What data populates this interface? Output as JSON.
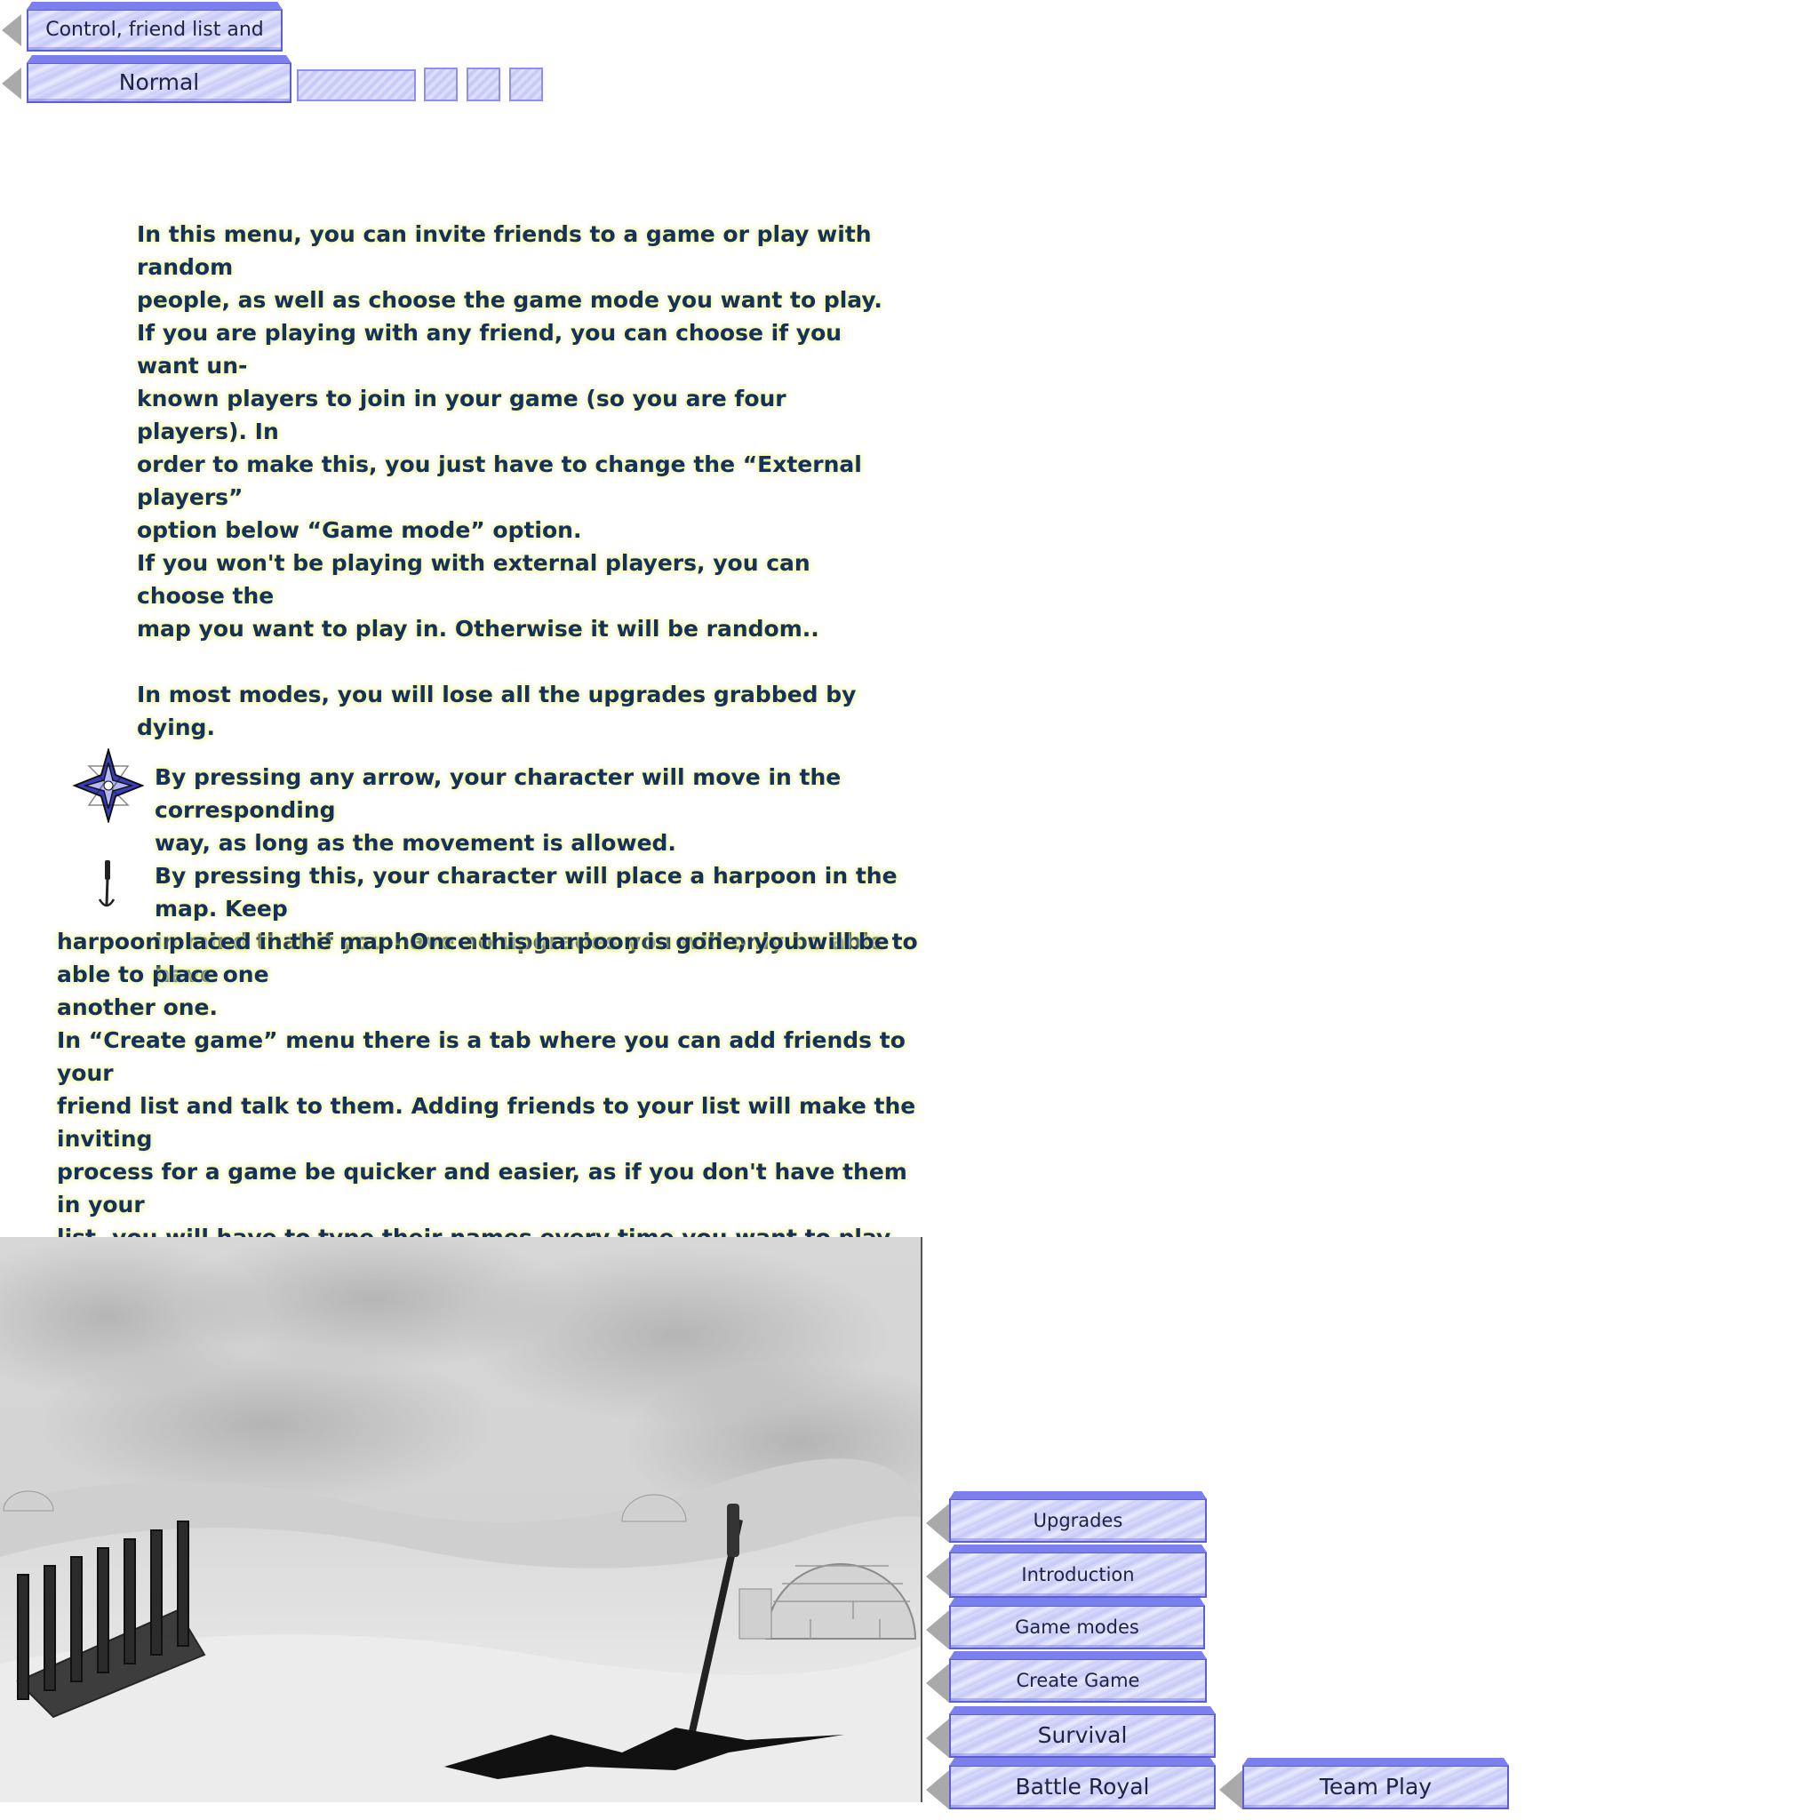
{
  "header": {
    "section_title": "Control, friend list and chat",
    "mode_label": "Normal"
  },
  "intro_text": "In this menu, you can invite friends to a game or play with random\npeople, as well as choose the game mode you want to play.\nIf you are playing with any friend, you can choose if you want un-\nknown players to join in your game (so you are four players). In\norder to make this, you just have to change the “External players”\noption below “Game mode” option.\nIf you won't be playing with external players, you can choose the\nmap you want to play in. Otherwise it will be random..\n\nIn most modes, you will lose all the upgrades grabbed by dying.",
  "controls": {
    "arrows_icon": "compass-arrows-icon",
    "arrows_text": "By pressing any arrow, your character will move in the corresponding\nway, as long as the movement is allowed.",
    "harpoon_icon": "harpoon-icon",
    "harpoon_text_1": "By pressing this, your character will place a harpoon in the map. Keep\nin mind that if you have no upgrades you will only be able to have one",
    "harpoon_text_2": "harpoon placed in the map. Once this harpoon is gone, you will be able to place\nanother one.",
    "friends_text": "In “Create game” menu there is a tab where you can add friends to your\nfriend list and talk to them. Adding friends to your list will make the inviting\nprocess for a game be quicker and easier, as if you don't have them in your\nlist, you will have to type their names every time you want to play with them."
  },
  "menu": {
    "upgrades": "Upgrades",
    "introduction": "Introduction",
    "game_modes": "Game modes",
    "create_game": "Create Game",
    "survival": "Survival",
    "battle_royal": "Battle Royal",
    "team_play": "Team Play"
  },
  "colors": {
    "button_fill": "#d0d3fa",
    "button_border": "#5a5fd8",
    "text": "#15305c",
    "text_glow": "#eef5a0"
  }
}
